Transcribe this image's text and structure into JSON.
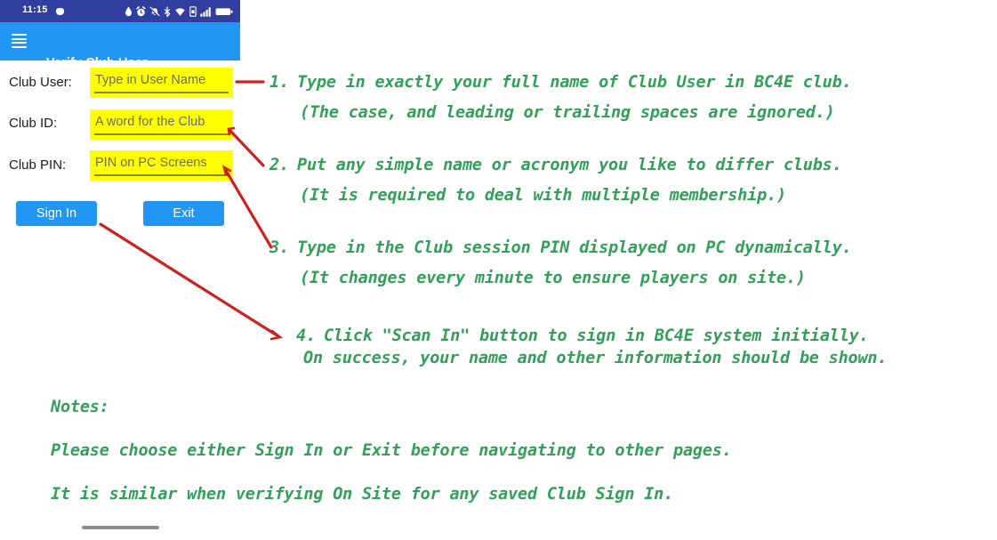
{
  "phone": {
    "status_bar": {
      "time": "11:15",
      "icons": [
        "water-drop-icon",
        "alarm-clock-icon",
        "bell-muted-icon",
        "bluetooth-icon",
        "wifi-icon",
        "sim-card-icon",
        "signal-bars-icon",
        "battery-icon"
      ],
      "bg_color": "#303f9f"
    },
    "app_bar": {
      "menu_icon": "hamburger-menu-icon",
      "title": "Verify Club User",
      "bg_color": "#2196f3"
    },
    "form": {
      "fields": [
        {
          "label": "Club User:",
          "placeholder": "Type in User Name",
          "value": ""
        },
        {
          "label": "Club ID:",
          "placeholder": "A word for the Club",
          "value": ""
        },
        {
          "label": "Club PIN:",
          "placeholder": "PIN on PC Screens",
          "value": ""
        }
      ],
      "highlight_color": "#ffff00",
      "buttons": [
        {
          "label": "Sign In"
        },
        {
          "label": "Exit"
        }
      ]
    },
    "gesture_bar": "home-gesture-bar"
  },
  "annotations": {
    "accent_color": "#33a05a",
    "arrow_color": "#cc2222",
    "steps": [
      {
        "num": "1.",
        "main": "Type in exactly your full name of Club User in BC4E club.",
        "sub": "(The case, and leading or trailing spaces are ignored.)"
      },
      {
        "num": "2.",
        "main": "Put any simple name or acronym you like to differ clubs.",
        "sub": "(It is required to deal with multiple membership.)"
      },
      {
        "num": "3.",
        "main": "Type in the Club session PIN displayed on PC dynamically.",
        "sub": "(It changes every minute to ensure players on site.)"
      },
      {
        "num": "4.",
        "main": "Click \"Scan In\" button to sign in BC4E system initially.",
        "sub": "On success, your name and other information should be shown."
      }
    ],
    "notes_heading": "Notes:",
    "notes": [
      "Please choose either Sign In or Exit before navigating to other pages.",
      "It is similar when verifying On Site for any saved Club Sign In."
    ]
  }
}
